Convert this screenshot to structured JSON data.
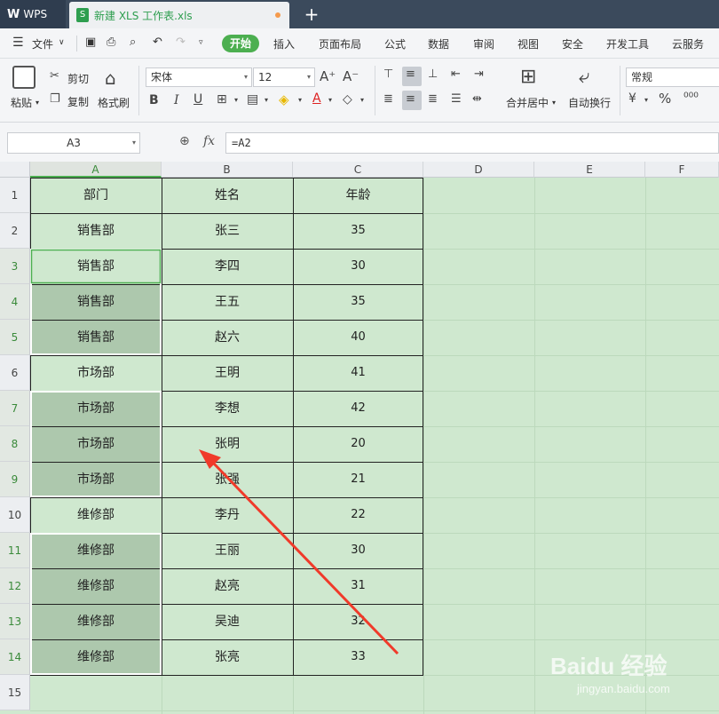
{
  "titlebar": {
    "app": "WPS",
    "file_tab": "新建 XLS 工作表.xls",
    "new_tab": "+"
  },
  "menubar": {
    "menu_label": "文件",
    "tabs": [
      "开始",
      "插入",
      "页面布局",
      "公式",
      "数据",
      "审阅",
      "视图",
      "安全",
      "开发工具",
      "云服务"
    ]
  },
  "ribbon": {
    "paste": "粘贴",
    "cut": "剪切",
    "copy": "复制",
    "format_painter": "格式刷",
    "font_name": "宋体",
    "font_size": "12",
    "merge_center": "合并居中",
    "wrap_text": "自动换行",
    "number_format": "常规"
  },
  "formula_bar": {
    "name_box": "A3",
    "fx": "fx",
    "formula": "=A2"
  },
  "columns": [
    "A",
    "B",
    "C",
    "D",
    "E",
    "F"
  ],
  "rows": [
    {
      "n": "1",
      "a": "部门",
      "b": "姓名",
      "c": "年龄"
    },
    {
      "n": "2",
      "a": "销售部",
      "b": "张三",
      "c": "35"
    },
    {
      "n": "3",
      "a": "销售部",
      "b": "李四",
      "c": "30"
    },
    {
      "n": "4",
      "a": "销售部",
      "b": "王五",
      "c": "35"
    },
    {
      "n": "5",
      "a": "销售部",
      "b": "赵六",
      "c": "40"
    },
    {
      "n": "6",
      "a": "市场部",
      "b": "王明",
      "c": "41"
    },
    {
      "n": "7",
      "a": "市场部",
      "b": "李想",
      "c": "42"
    },
    {
      "n": "8",
      "a": "市场部",
      "b": "张明",
      "c": "20"
    },
    {
      "n": "9",
      "a": "市场部",
      "b": "张强",
      "c": "21"
    },
    {
      "n": "10",
      "a": "维修部",
      "b": "李丹",
      "c": "22"
    },
    {
      "n": "11",
      "a": "维修部",
      "b": "王丽",
      "c": "30"
    },
    {
      "n": "12",
      "a": "维修部",
      "b": "赵亮",
      "c": "31"
    },
    {
      "n": "13",
      "a": "维修部",
      "b": "吴迪",
      "c": "32"
    },
    {
      "n": "14",
      "a": "维修部",
      "b": "张亮",
      "c": "33"
    },
    {
      "n": "15",
      "a": "",
      "b": "",
      "c": ""
    }
  ],
  "colors": {
    "accent": "#4caf50",
    "grid_bg": "#cfe8cf",
    "selected_fill": "#adc8ad",
    "arrow": "#f03a2a"
  },
  "watermark": {
    "line1": "Baidu 经验",
    "line2": "jingyan.baidu.com"
  }
}
